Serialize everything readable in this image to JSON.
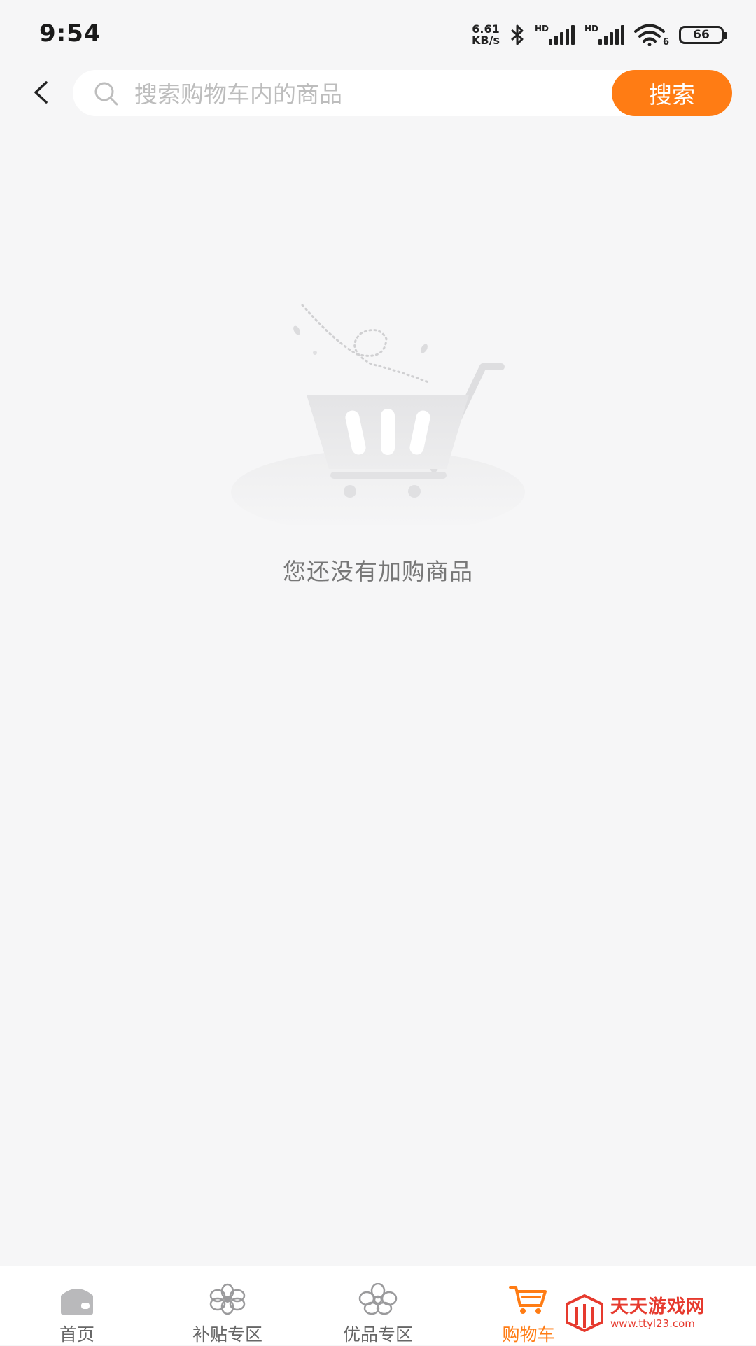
{
  "status_bar": {
    "time": "9:54",
    "net_speed_value": "6.61",
    "net_speed_unit": "KB/s",
    "signal_1_label": "HD",
    "signal_2_label": "HD",
    "wifi_label": "6",
    "battery": "66",
    "icons": [
      "bluetooth-icon",
      "signal-icon",
      "signal-icon",
      "wifi-icon",
      "battery-icon"
    ]
  },
  "header": {
    "search_placeholder": "搜索购物车内的商品",
    "search_button": "搜索"
  },
  "empty_state": {
    "message": "您还没有加购商品"
  },
  "tab_bar": {
    "accent_color": "#ff7c14",
    "tabs": [
      {
        "label": "首页",
        "icon": "home-icon",
        "active": false
      },
      {
        "label": "补贴专区",
        "icon": "flower-icon",
        "active": false
      },
      {
        "label": "优品专区",
        "icon": "flower-outline-icon",
        "active": false
      },
      {
        "label": "购物车",
        "icon": "cart-icon",
        "active": true
      }
    ]
  },
  "watermark": {
    "title": "天天游戏网",
    "url": "www.ttyl23.com"
  }
}
